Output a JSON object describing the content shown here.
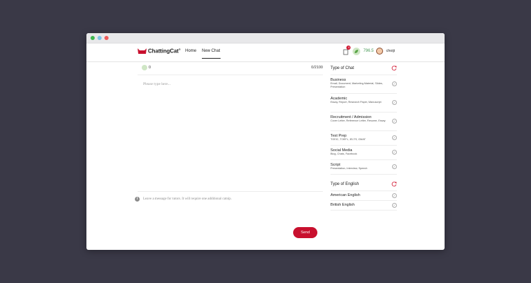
{
  "brand": {
    "name": "ChattingCat",
    "trademark": "®",
    "accent": "#c8102e"
  },
  "nav": {
    "items": [
      {
        "label": "Home"
      },
      {
        "label": "New Chat"
      }
    ],
    "active": "New Chat"
  },
  "user": {
    "notifications": "8",
    "catnip_points": "796.5",
    "username": "choiji"
  },
  "composer": {
    "catnip_cost": "0",
    "char_count": "0/2100",
    "placeholder": "Please type here...",
    "tutor_message": "Leave a message for tutors. It will require one additional catnip.",
    "send_label": "Send"
  },
  "type_of_chat": {
    "title": "Type of Chat",
    "options": [
      {
        "title": "Business",
        "subtitle": "Email, Document, Marketing Material, Slides, Presentation"
      },
      {
        "title": "Academic",
        "subtitle": "Essay, Report, Research Paper, Manuscript"
      },
      {
        "title": "Recruitment / Admission",
        "subtitle": "Cover Letter, Reference Letter, Resume, Essay"
      },
      {
        "title": "Test Prep",
        "subtitle": "TOEIC, TOEFL, IELTS, GMAT"
      },
      {
        "title": "Social Media",
        "subtitle": "Blog, Chats, Facebook"
      },
      {
        "title": "Script",
        "subtitle": "Presentation, Interview, Speech"
      }
    ]
  },
  "type_of_english": {
    "title": "Type of English",
    "options": [
      {
        "title": "American English"
      },
      {
        "title": "British English"
      }
    ]
  },
  "icons": {
    "check": "check-circle-icon",
    "reset": "reset-icon",
    "info": "info-icon"
  }
}
